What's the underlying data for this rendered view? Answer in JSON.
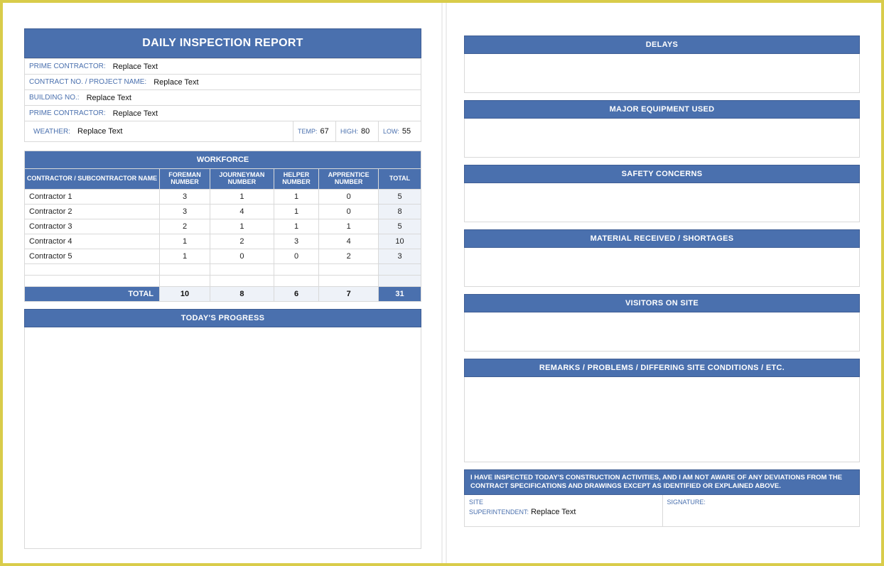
{
  "title": "DAILY INSPECTION REPORT",
  "info": {
    "prime_contractor_label": "PRIME CONTRACTOR:",
    "prime_contractor_value": "Replace Text",
    "contract_label": "CONTRACT NO. / PROJECT NAME:",
    "contract_value": "Replace Text",
    "building_label": "BUILDING NO.:",
    "building_value": "Replace Text",
    "prime_contractor2_label": "PRIME CONTRACTOR:",
    "prime_contractor2_value": "Replace Text",
    "weather_label": "WEATHER:",
    "weather_value": "Replace Text",
    "temp_label": "TEMP:",
    "temp_value": "67",
    "high_label": "HIGH:",
    "high_value": "80",
    "low_label": "LOW:",
    "low_value": "55"
  },
  "workforce": {
    "header": "WORKFORCE",
    "cols": {
      "name": "CONTRACTOR / SUBCONTRACTOR NAME",
      "foreman": "FOREMAN NUMBER",
      "journeyman": "JOURNEYMAN NUMBER",
      "helper": "HELPER NUMBER",
      "apprentice": "APPRENTICE NUMBER",
      "total": "TOTAL"
    },
    "rows": [
      {
        "name": "Contractor 1",
        "foreman": "3",
        "journeyman": "1",
        "helper": "1",
        "apprentice": "0",
        "total": "5"
      },
      {
        "name": "Contractor 2",
        "foreman": "3",
        "journeyman": "4",
        "helper": "1",
        "apprentice": "0",
        "total": "8"
      },
      {
        "name": "Contractor 3",
        "foreman": "2",
        "journeyman": "1",
        "helper": "1",
        "apprentice": "1",
        "total": "5"
      },
      {
        "name": "Contractor 4",
        "foreman": "1",
        "journeyman": "2",
        "helper": "3",
        "apprentice": "4",
        "total": "10"
      },
      {
        "name": "Contractor 5",
        "foreman": "1",
        "journeyman": "0",
        "helper": "0",
        "apprentice": "2",
        "total": "3"
      }
    ],
    "totals_label": "TOTAL",
    "totals": {
      "foreman": "10",
      "journeyman": "8",
      "helper": "6",
      "apprentice": "7",
      "total": "31"
    }
  },
  "progress_header": "TODAY'S PROGRESS",
  "right": {
    "delays": "DELAYS",
    "equipment": "MAJOR EQUIPMENT USED",
    "safety": "SAFETY CONCERNS",
    "material": "MATERIAL RECEIVED / SHORTAGES",
    "visitors": "VISITORS ON SITE",
    "remarks": "REMARKS / PROBLEMS / DIFFERING SITE CONDITIONS / ETC."
  },
  "cert_text": "I HAVE INSPECTED TODAY'S CONSTRUCTION ACTIVITIES, AND I AM NOT AWARE OF ANY DEVIATIONS FROM THE CONTRACT SPECIFICATIONS AND DRAWINGS EXCEPT AS IDENTIFIED OR EXPLAINED ABOVE.",
  "sig": {
    "super_label1": "SITE",
    "super_label2": "SUPERINTENDENT:",
    "super_value": "Replace Text",
    "signature_label": "SIGNATURE:"
  }
}
